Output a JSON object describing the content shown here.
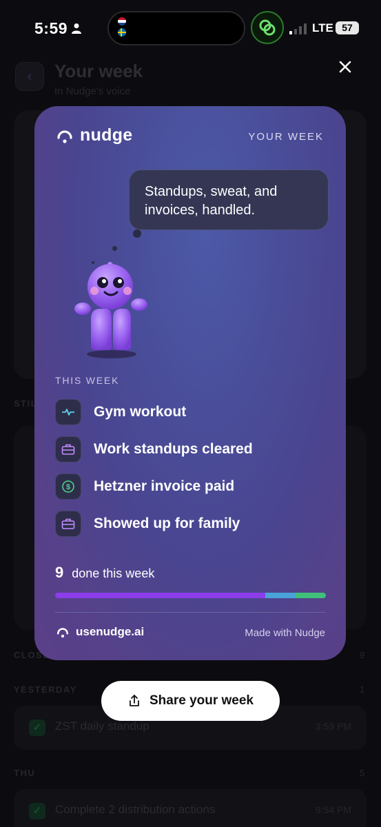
{
  "status_bar": {
    "time": "5:59",
    "network": "LTE",
    "battery": "57"
  },
  "background_page": {
    "title": "Your week",
    "subtitle": "In Nudge's voice",
    "sections": [
      {
        "label": "STIL",
        "count": ""
      },
      {
        "label": "CLOSE",
        "count": "9"
      },
      {
        "label": "YESTERDAY",
        "count": "1"
      },
      {
        "label": "THU",
        "count": "5"
      }
    ],
    "rows": [
      {
        "label": "ZST daily standup",
        "time": "3:59 PM"
      },
      {
        "label": "Complete 2 distribution actions",
        "time": "9:54 PM"
      }
    ]
  },
  "card": {
    "brand": "nudge",
    "tag": "YOUR WEEK",
    "speech": "Standups, sweat, and invoices, handled.",
    "section_label": "THIS WEEK",
    "tasks": [
      {
        "label": "Gym workout",
        "icon": "pulse-icon"
      },
      {
        "label": "Work standups cleared",
        "icon": "briefcase-icon"
      },
      {
        "label": "Hetzner invoice paid",
        "icon": "dollar-icon"
      },
      {
        "label": "Showed up for family",
        "icon": "briefcase-icon"
      }
    ],
    "done_count": "9",
    "done_label": "done this week",
    "progress": {
      "segments": [
        {
          "fraction": 0.777,
          "color": "#8b3dea"
        },
        {
          "fraction": 0.11,
          "color": "#4aa3d8"
        },
        {
          "fraction": 0.113,
          "color": "#3fbf7a"
        }
      ]
    },
    "footer_url": "usenudge.ai",
    "footer_made": "Made with Nudge"
  },
  "share_button": {
    "label": "Share your week"
  },
  "colors": {
    "accent_purple": "#8b3dea",
    "accent_blue": "#4aa3d8",
    "accent_green": "#3fbf7a"
  }
}
